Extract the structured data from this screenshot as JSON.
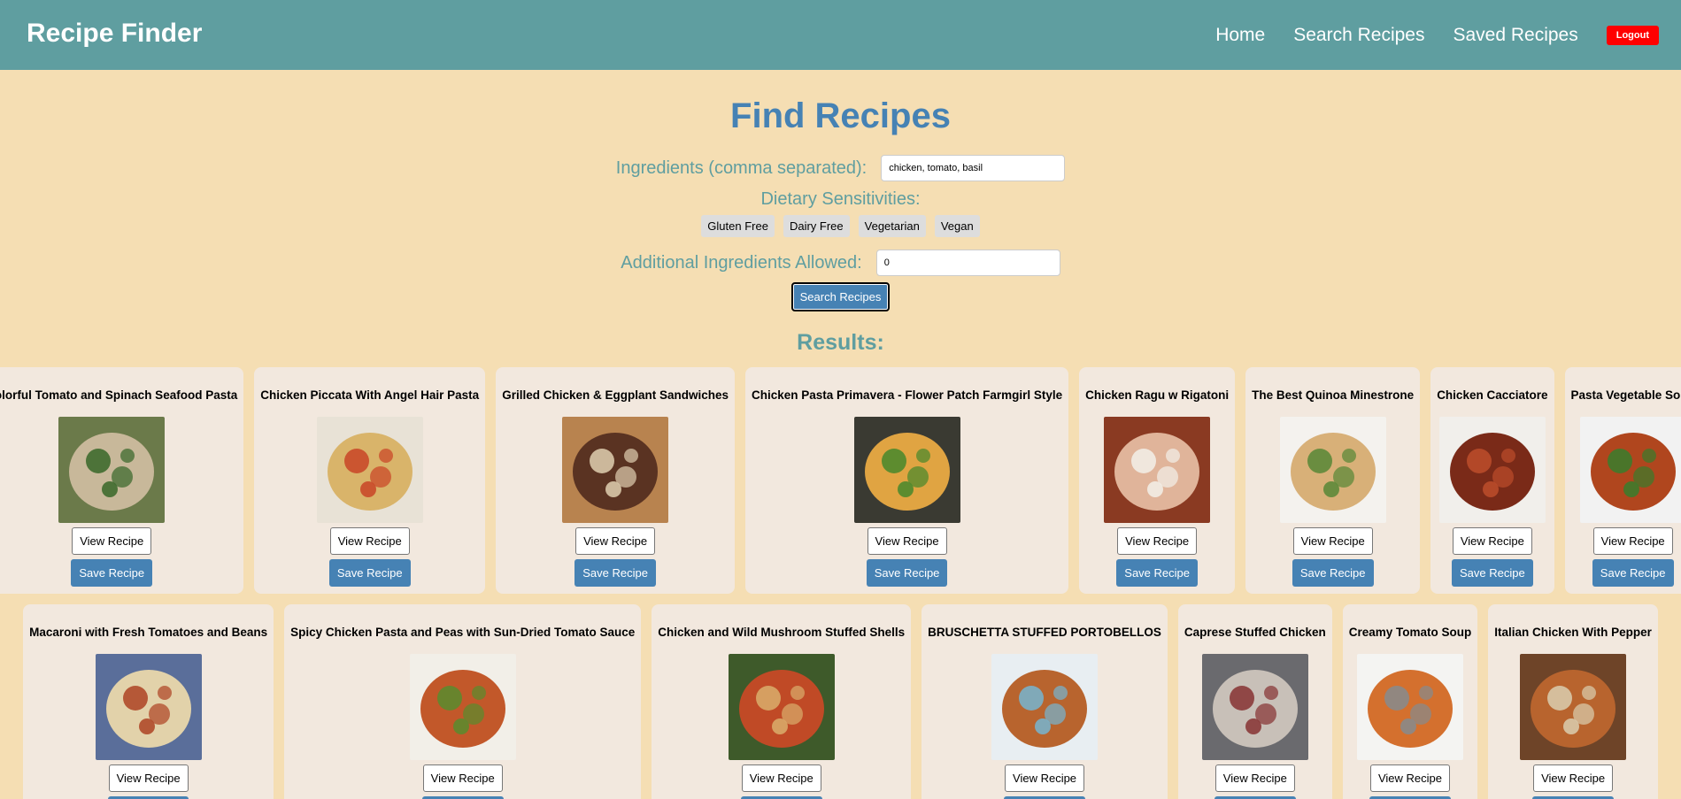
{
  "app": {
    "title": "Recipe Finder"
  },
  "nav": {
    "home": "Home",
    "search": "Search Recipes",
    "saved": "Saved Recipes",
    "logout": "Logout"
  },
  "search": {
    "title": "Find Recipes",
    "ingredients_label": "Ingredients (comma separated):",
    "ingredients_value": "chicken, tomato, basil",
    "dietary_label": "Dietary Sensitivities:",
    "dietary_options": [
      "Gluten Free",
      "Dairy Free",
      "Vegetarian",
      "Vegan"
    ],
    "additional_label": "Additional Ingredients Allowed:",
    "additional_value": "0",
    "submit_label": "Search Recipes"
  },
  "results": {
    "title": "Results:",
    "view_label": "View Recipe",
    "save_label": "Save Recipe",
    "rows": [
      [
        {
          "title": "Colorful Tomato and Spinach Seafood Pasta",
          "image_colors": [
            "#6b7a4a",
            "#c8b89a",
            "#3f6b2f"
          ]
        },
        {
          "title": "Chicken Piccata With Angel Hair Pasta",
          "image_colors": [
            "#e8e2d6",
            "#d9b46a",
            "#c94a2a"
          ]
        },
        {
          "title": "Grilled Chicken & Eggplant Sandwiches",
          "image_colors": [
            "#b8834f",
            "#5a3322",
            "#d8c6a8"
          ]
        },
        {
          "title": "Chicken Pasta Primavera - Flower Patch Farmgirl Style",
          "image_colors": [
            "#3a3a32",
            "#e0a442",
            "#4f8a2e"
          ]
        },
        {
          "title": "Chicken Ragu w Rigatoni",
          "image_colors": [
            "#8a3a22",
            "#e0b49a",
            "#f2ece4"
          ]
        },
        {
          "title": "The Best Quinoa Minestrone",
          "image_colors": [
            "#f4f2ee",
            "#d8b078",
            "#5e8a3a"
          ]
        },
        {
          "title": "Chicken Cacciatore",
          "image_colors": [
            "#f1efeb",
            "#7a2a18",
            "#b94b2a"
          ]
        },
        {
          "title": "Pasta Vegetable Soup",
          "image_colors": [
            "#f2f2f2",
            "#b0461e",
            "#3f7a2b"
          ]
        }
      ],
      [
        {
          "title": "Macaroni with Fresh Tomatoes and Beans",
          "image_colors": [
            "#5a6e9a",
            "#e2d2aa",
            "#b04a2a"
          ]
        },
        {
          "title": "Spicy Chicken Pasta and Peas with Sun-Dried Tomato Sauce",
          "image_colors": [
            "#f2efe8",
            "#c2582a",
            "#5e8a2e"
          ]
        },
        {
          "title": "Chicken and Wild Mushroom Stuffed Shells",
          "image_colors": [
            "#3e5a2a",
            "#c04a26",
            "#d8a868"
          ]
        },
        {
          "title": "BRUSCHETTA STUFFED PORTOBELLOS",
          "image_colors": [
            "#e8eef2",
            "#b8642e",
            "#7ab0c8"
          ]
        },
        {
          "title": "Caprese Stuffed Chicken",
          "image_colors": [
            "#6a6a6e",
            "#c8c0b8",
            "#8a3a3a"
          ]
        },
        {
          "title": "Creamy Tomato Soup",
          "image_colors": [
            "#f4f4f2",
            "#d4702e",
            "#8a8a8a"
          ]
        },
        {
          "title": "Italian Chicken With Pepper",
          "image_colors": [
            "#6e4428",
            "#b8642e",
            "#d8c8a8"
          ]
        }
      ]
    ]
  }
}
